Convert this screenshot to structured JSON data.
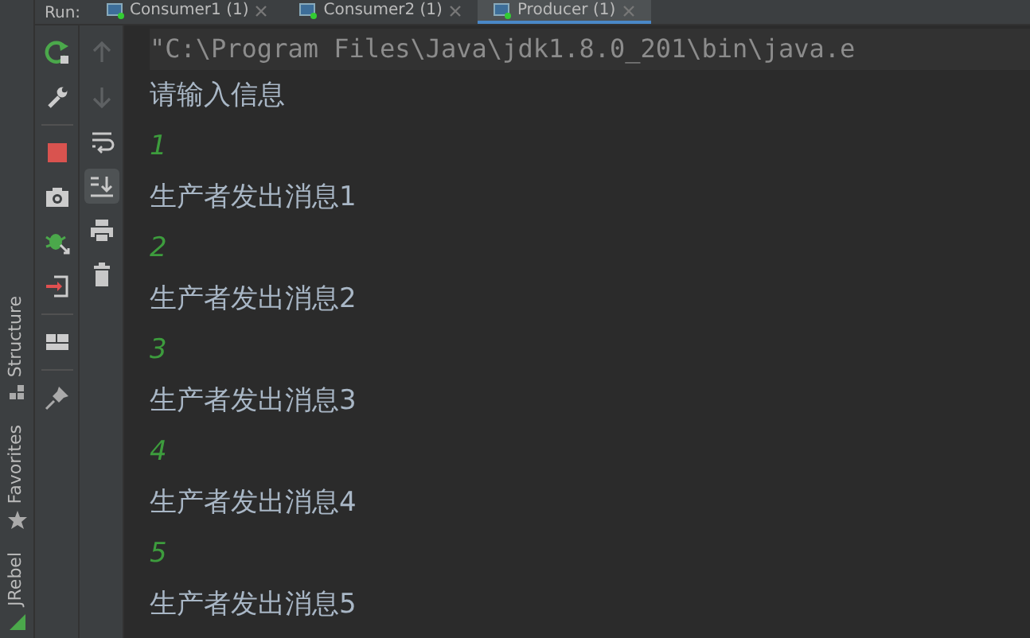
{
  "side_tabs": [
    {
      "label": "Structure"
    },
    {
      "label": "Favorites"
    },
    {
      "label": "JRebel"
    }
  ],
  "run_label": "Run:",
  "tabs": [
    {
      "label": "Consumer1 (1)",
      "selected": false
    },
    {
      "label": "Consumer2 (1)",
      "selected": false
    },
    {
      "label": "Producer (1)",
      "selected": true
    }
  ],
  "toolbar_left": [
    {
      "kind": "rerun"
    },
    {
      "kind": "wrench"
    },
    {
      "kind": "sep"
    },
    {
      "kind": "stop"
    },
    {
      "kind": "camera"
    },
    {
      "kind": "debug"
    },
    {
      "kind": "exit"
    },
    {
      "kind": "sep"
    },
    {
      "kind": "layout"
    },
    {
      "kind": "sep"
    },
    {
      "kind": "pin"
    }
  ],
  "toolbar_right": [
    {
      "kind": "up",
      "disabled": true,
      "selected": false
    },
    {
      "kind": "down",
      "disabled": true,
      "selected": false
    },
    {
      "kind": "wrap",
      "disabled": false,
      "selected": false
    },
    {
      "kind": "scroll",
      "disabled": false,
      "selected": true
    },
    {
      "kind": "print",
      "disabled": false,
      "selected": false
    },
    {
      "kind": "trash",
      "disabled": false,
      "selected": false
    }
  ],
  "console": [
    {
      "kind": "command",
      "text": "\"C:\\Program Files\\Java\\jdk1.8.0_201\\bin\\java.e"
    },
    {
      "kind": "output",
      "text": "请输入信息"
    },
    {
      "kind": "input",
      "text": "1"
    },
    {
      "kind": "output",
      "text": "生产者发出消息1"
    },
    {
      "kind": "input",
      "text": "2"
    },
    {
      "kind": "output",
      "text": "生产者发出消息2"
    },
    {
      "kind": "input",
      "text": "3"
    },
    {
      "kind": "output",
      "text": "生产者发出消息3"
    },
    {
      "kind": "input",
      "text": "4"
    },
    {
      "kind": "output",
      "text": "生产者发出消息4"
    },
    {
      "kind": "input",
      "text": "5"
    },
    {
      "kind": "output",
      "text": "生产者发出消息5"
    }
  ]
}
